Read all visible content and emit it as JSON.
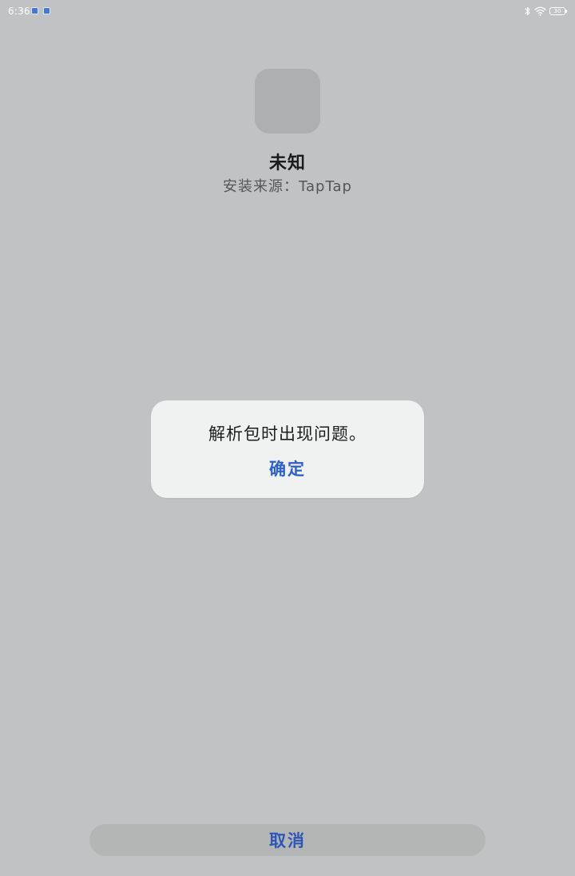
{
  "status_bar": {
    "time": "6:36",
    "notification_icons": [
      "app-notification-icon",
      "app-notification-icon"
    ],
    "system_icons": [
      "bluetooth-icon",
      "wifi-icon",
      "battery-icon"
    ],
    "battery_level": "30"
  },
  "app": {
    "icon": "app-placeholder-icon",
    "name": "未知",
    "install_source": "安装来源：TapTap"
  },
  "dialog": {
    "message": "解析包时出现问题。",
    "confirm_label": "确定"
  },
  "footer": {
    "cancel_label": "取消"
  },
  "colors": {
    "background": "#c1c2c4",
    "dialog_background": "#f0f2f1",
    "accent": "#2c5fd0"
  }
}
